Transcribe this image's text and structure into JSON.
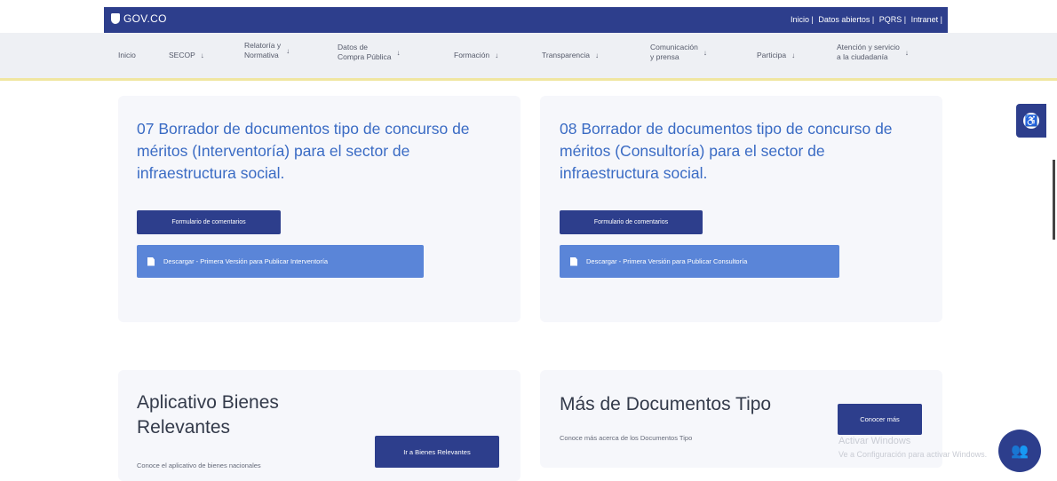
{
  "header": {
    "logo_text": "GOV.CO",
    "links": [
      "Inicio |",
      "Datos abiertos |",
      "PQRS |",
      "Intranet |"
    ]
  },
  "nav": {
    "items": [
      {
        "label": "Inicio",
        "arrow": ""
      },
      {
        "label": "SECOP",
        "arrow": "↓"
      },
      {
        "label": "Relatoría y\nNormativa",
        "arrow": "↓"
      },
      {
        "label": "Datos de\nCompra Pública",
        "arrow": "↓"
      },
      {
        "label": "Formación",
        "arrow": "↓"
      },
      {
        "label": "Transparencia",
        "arrow": "↓"
      },
      {
        "label": "Comunicación\ny prensa",
        "arrow": "↓"
      },
      {
        "label": "Participa",
        "arrow": "↓"
      },
      {
        "label": "Atención y servicio\na la ciudadanía",
        "arrow": "↓"
      }
    ]
  },
  "cards": [
    {
      "title": "07 Borrador de documentos tipo de concurso de méritos (Interventoría) para el sector de infraestructura social.",
      "form_button": "Formulario de comentarios",
      "download_button": "Descargar - Primera Versión para Publicar Interventoría"
    },
    {
      "title": "08 Borrador de documentos tipo de concurso de méritos (Consultoría) para el sector de infraestructura social.",
      "form_button": "Formulario de comentarios",
      "download_button": "Descargar - Primera Versión para Publicar Consultoría"
    }
  ],
  "bienes": {
    "title": "Aplicativo Bienes Relevantes",
    "text": "Conoce el aplicativo de bienes nacionales",
    "button": "Ir a Bienes Relevantes"
  },
  "mas": {
    "title": "Más de Documentos Tipo",
    "text": "Conoce más acerca de los Documentos Tipo",
    "button": "Conocer más"
  },
  "watermark": {
    "line1": "Activar Windows",
    "line2": "Ve a Configuración para activar Windows."
  },
  "colors": {
    "primary": "#2d3e8c",
    "link": "#3a6bc4",
    "button_light": "#5a85d8"
  }
}
